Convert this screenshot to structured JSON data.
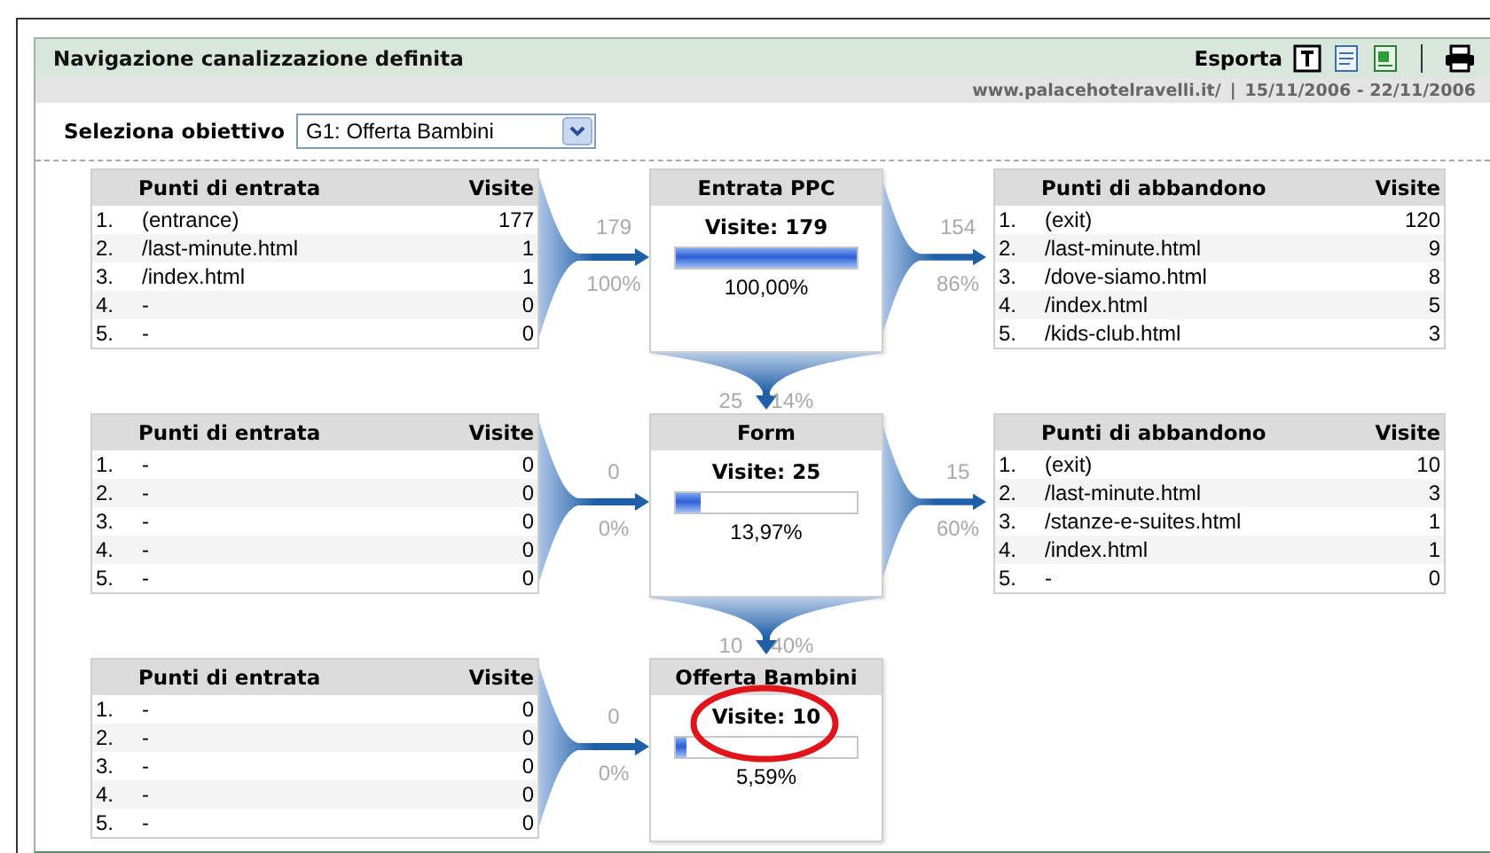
{
  "header": {
    "title": "Navigazione canalizzazione definita",
    "export_label": "Esporta",
    "site": "www.palacehotelravelli.it/",
    "separator": "|",
    "date_range": "15/11/2006 - 22/11/2006"
  },
  "goal": {
    "label": "Seleziona obiettivo",
    "value": "G1: Offerta Bambini"
  },
  "stages": [
    {
      "entries": {
        "heading": "Punti di entrata",
        "visits_heading": "Visite",
        "rows": [
          {
            "rank": "1.",
            "page": "(entrance)",
            "visits": "177"
          },
          {
            "rank": "2.",
            "page": "/last-minute.html",
            "visits": "1"
          },
          {
            "rank": "3.",
            "page": "/index.html",
            "visits": "1"
          },
          {
            "rank": "4.",
            "page": "-",
            "visits": "0"
          },
          {
            "rank": "5.",
            "page": "-",
            "visits": "0"
          }
        ]
      },
      "in_count": "179",
      "in_pct": "100%",
      "step": {
        "title": "Entrata PPC",
        "visits": "Visite: 179",
        "level": 1.0,
        "pct": "100,00%",
        "circled": false
      },
      "out_count": "154",
      "out_pct": "86%",
      "exits": {
        "heading": "Punti di abbandono",
        "visits_heading": "Visite",
        "rows": [
          {
            "rank": "1.",
            "page": "(exit)",
            "visits": "120"
          },
          {
            "rank": "2.",
            "page": "/last-minute.html",
            "visits": "9"
          },
          {
            "rank": "3.",
            "page": "/dove-siamo.html",
            "visits": "8"
          },
          {
            "rank": "4.",
            "page": "/index.html",
            "visits": "5"
          },
          {
            "rank": "5.",
            "page": "/kids-club.html",
            "visits": "3"
          }
        ]
      },
      "next_count": "25",
      "next_pct": "14%"
    },
    {
      "entries": {
        "heading": "Punti di entrata",
        "visits_heading": "Visite",
        "rows": [
          {
            "rank": "1.",
            "page": "-",
            "visits": "0"
          },
          {
            "rank": "2.",
            "page": "-",
            "visits": "0"
          },
          {
            "rank": "3.",
            "page": "-",
            "visits": "0"
          },
          {
            "rank": "4.",
            "page": "-",
            "visits": "0"
          },
          {
            "rank": "5.",
            "page": "-",
            "visits": "0"
          }
        ]
      },
      "in_count": "0",
      "in_pct": "0%",
      "step": {
        "title": "Form",
        "visits": "Visite: 25",
        "level": 0.1397,
        "pct": "13,97%",
        "circled": false
      },
      "out_count": "15",
      "out_pct": "60%",
      "exits": {
        "heading": "Punti di abbandono",
        "visits_heading": "Visite",
        "rows": [
          {
            "rank": "1.",
            "page": "(exit)",
            "visits": "10"
          },
          {
            "rank": "2.",
            "page": "/last-minute.html",
            "visits": "3"
          },
          {
            "rank": "3.",
            "page": "/stanze-e-suites.html",
            "visits": "1"
          },
          {
            "rank": "4.",
            "page": "/index.html",
            "visits": "1"
          },
          {
            "rank": "5.",
            "page": "-",
            "visits": "0"
          }
        ]
      },
      "next_count": "10",
      "next_pct": "40%"
    },
    {
      "entries": {
        "heading": "Punti di entrata",
        "visits_heading": "Visite",
        "rows": [
          {
            "rank": "1.",
            "page": "-",
            "visits": "0"
          },
          {
            "rank": "2.",
            "page": "-",
            "visits": "0"
          },
          {
            "rank": "3.",
            "page": "-",
            "visits": "0"
          },
          {
            "rank": "4.",
            "page": "-",
            "visits": "0"
          },
          {
            "rank": "5.",
            "page": "-",
            "visits": "0"
          }
        ]
      },
      "in_count": "0",
      "in_pct": "0%",
      "step": {
        "title": "Offerta Bambini",
        "visits": "Visite: 10",
        "level": 0.0559,
        "pct": "5,59%",
        "circled": true
      }
    }
  ]
}
